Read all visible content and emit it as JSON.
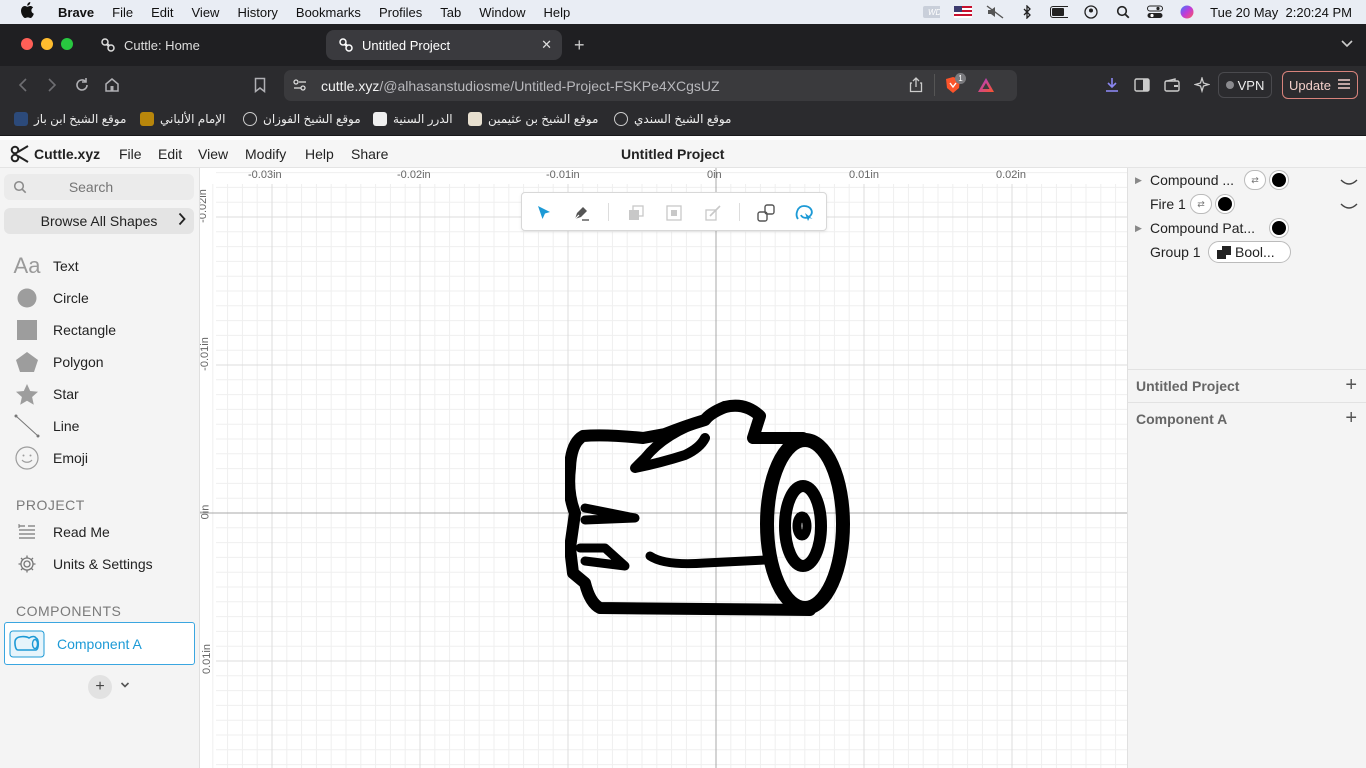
{
  "macos_menubar": {
    "app": "Brave",
    "menus": [
      "File",
      "Edit",
      "View",
      "History",
      "Bookmarks",
      "Profiles",
      "Tab",
      "Window",
      "Help"
    ],
    "status_icons": [
      "wd-icon",
      "flag-us-icon",
      "mute-icon",
      "bluetooth-icon",
      "battery-icon",
      "user-icon",
      "spotlight-icon",
      "control-center-icon",
      "siri-icon"
    ],
    "datetime": "Tue 20 May  2:20:24 PM"
  },
  "browser": {
    "tabs": [
      {
        "title": "Cuttle: Home",
        "active": false
      },
      {
        "title": "Untitled Project",
        "active": true
      }
    ],
    "url_host": "cuttle.xyz",
    "url_path": "/@alhasanstudiosme/Untitled-Project-FSKPe4XCgsUZ",
    "shield_badge": "1",
    "vpn_label": "VPN",
    "update_label": "Update",
    "bookmarks": [
      "موقع الشيخ ابن باز",
      "الإمام الألباني",
      "موقع الشيخ الفوزان",
      "الدرر السنية",
      "موقع الشيخ بن عثيمين",
      "موقع الشيخ السندي"
    ]
  },
  "app": {
    "logo_text": "Cuttle.xyz",
    "menus": [
      "File",
      "Edit",
      "View",
      "Modify",
      "Help",
      "Share"
    ],
    "project_title": "Untitled Project"
  },
  "sidebar": {
    "search_placeholder": "Search",
    "browse_label": "Browse All Shapes",
    "shapes": [
      {
        "label": "Text",
        "icon": "text-icon"
      },
      {
        "label": "Circle",
        "icon": "circle-icon"
      },
      {
        "label": "Rectangle",
        "icon": "rectangle-icon"
      },
      {
        "label": "Polygon",
        "icon": "polygon-icon"
      },
      {
        "label": "Star",
        "icon": "star-icon"
      },
      {
        "label": "Line",
        "icon": "line-icon"
      },
      {
        "label": "Emoji",
        "icon": "emoji-icon"
      }
    ],
    "project_heading": "PROJECT",
    "project_items": [
      {
        "label": "Read Me",
        "icon": "readme-icon"
      },
      {
        "label": "Units & Settings",
        "icon": "gear-icon"
      }
    ],
    "components_heading": "COMPONENTS",
    "component": "Component A"
  },
  "canvas": {
    "ruler_x": [
      "-0.03in",
      "-0.02in",
      "-0.01in",
      "0in",
      "0.01in",
      "0.02in"
    ],
    "ruler_y": [
      "-0.02in",
      "-0.01in",
      "0in",
      "0.01in"
    ],
    "tools": [
      "select-tool",
      "pen-tool",
      "boolean-union-tool",
      "boolean-subtract-tool",
      "boolean-intersect-tool",
      "link-tool",
      "lasso-tool"
    ]
  },
  "layers": {
    "items": [
      {
        "name": "Compound ...",
        "expandable": true
      },
      {
        "name": "Fire 1",
        "expandable": false
      },
      {
        "name": "Compound Pat...",
        "expandable": true
      },
      {
        "name": "Group 1",
        "expandable": false,
        "badge": "Bool..."
      }
    ],
    "sections": [
      "Untitled Project",
      "Component A"
    ]
  },
  "colors": {
    "accent": "#1d9ad6",
    "brave_orange": "#fb542b"
  }
}
